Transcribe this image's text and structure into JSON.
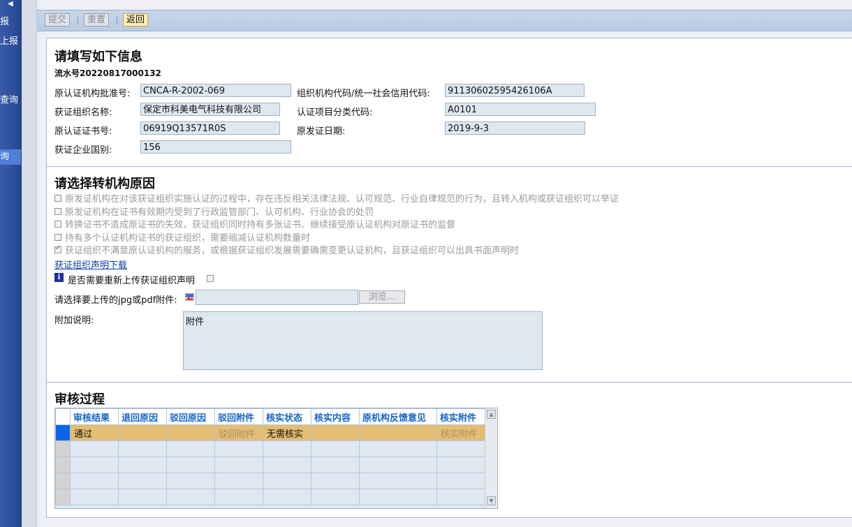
{
  "nav": {
    "items": [
      {
        "label": "报"
      },
      {
        "label": "上报"
      },
      {
        "label": "查询"
      },
      {
        "label": "询"
      }
    ]
  },
  "toolbar": {
    "submit_label": "提交",
    "reset_label": "重置",
    "back_label": "返回"
  },
  "info": {
    "title": "请填写如下信息",
    "serial": "流水号20220817000132",
    "fields": {
      "orig_approval_no": {
        "label": "原认证机构批准号:",
        "value": "CNCA-R-2002-069"
      },
      "org_code": {
        "label": "组织机构代码/统一社会信用代码:",
        "value": "91130602595426106A"
      },
      "org_name": {
        "label": "获证组织名称:",
        "value": "保定市科美电气科技有限公司"
      },
      "category_code": {
        "label": "认证项目分类代码:",
        "value": "A0101"
      },
      "cert_no": {
        "label": "原认证证书号:",
        "value": "06919Q13571R0S"
      },
      "issue_date": {
        "label": "原发证日期:",
        "value": "2019-9-3"
      },
      "country": {
        "label": "获证企业国别:",
        "value": "156"
      }
    }
  },
  "reasons": {
    "title": "请选择转机构原因",
    "options": [
      {
        "label": "原发证机构在对该获证组织实施认证的过程中，存在违反相关法律法规、认可规范、行业自律规范的行为，且转入机构或获证组织可以举证",
        "checked": false
      },
      {
        "label": "原发证机构在证书有效期内受到了行政监管部门、认可机构、行业协会的处罚",
        "checked": false
      },
      {
        "label": "转换证书不造成原证书的失效，获证组织同时持有多张证书、继续接受原认证机构对原证书的监督",
        "checked": false
      },
      {
        "label": "持有多个认证机构证书的获证组织，需要缩减认证机构数量时",
        "checked": false
      },
      {
        "label": "获证组织不满意原认证机构的服务，或根据获证组织发展需要确需变更认证机构，且获证组织可以出具书面声明时",
        "checked": true
      }
    ],
    "download_link": "获证组织声明下载",
    "reupload_label": "是否需要重新上传获证组织声明",
    "upload_label": "请选择要上传的jpg或pdf附件:",
    "browse_label": "浏览...",
    "remarks_label": "附加说明:",
    "remarks_value": "附件"
  },
  "audit": {
    "title": "审核过程",
    "columns": [
      "审核结果",
      "退回原因",
      "驳回原因",
      "驳回附件",
      "核实状态",
      "核实内容",
      "原机构反馈意见",
      "核实附件"
    ],
    "rows": [
      [
        "通过",
        "",
        "",
        "驳回附件",
        "无需核实",
        "",
        "",
        "核实附件"
      ]
    ]
  }
}
